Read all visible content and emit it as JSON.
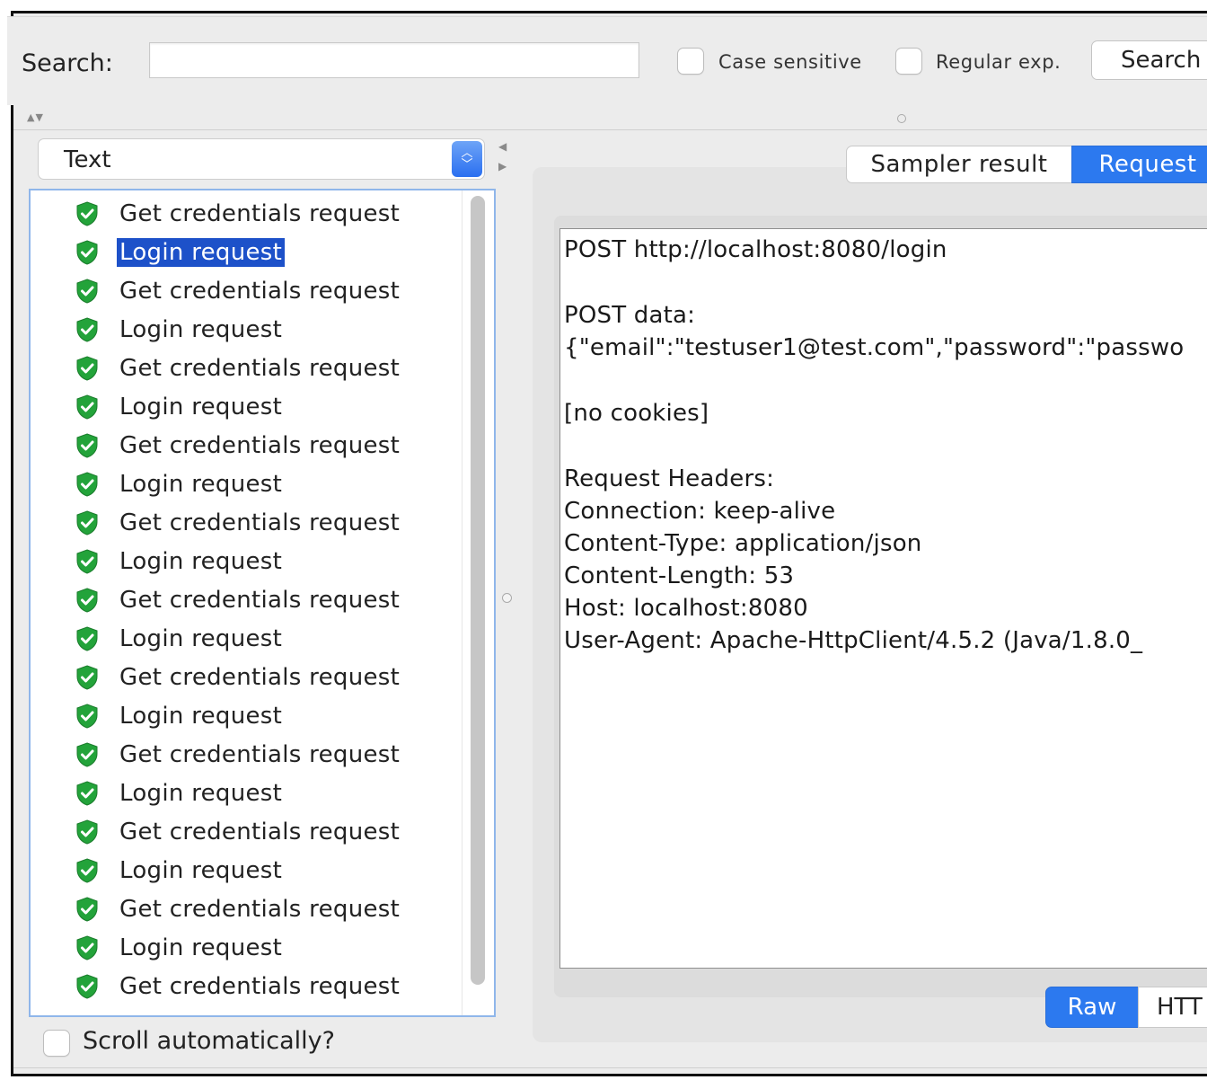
{
  "search": {
    "label": "Search:",
    "value": "",
    "case_sensitive_label": "Case sensitive",
    "regex_label": "Regular exp.",
    "button_label": "Search"
  },
  "renderer": {
    "selected": "Text"
  },
  "tree": {
    "items": [
      {
        "label": "Get credentials request",
        "status": "success"
      },
      {
        "label": "Login request",
        "status": "success",
        "selected": true
      },
      {
        "label": "Get credentials request",
        "status": "success"
      },
      {
        "label": "Login request",
        "status": "success"
      },
      {
        "label": "Get credentials request",
        "status": "success"
      },
      {
        "label": "Login request",
        "status": "success"
      },
      {
        "label": "Get credentials request",
        "status": "success"
      },
      {
        "label": "Login request",
        "status": "success"
      },
      {
        "label": "Get credentials request",
        "status": "success"
      },
      {
        "label": "Login request",
        "status": "success"
      },
      {
        "label": "Get credentials request",
        "status": "success"
      },
      {
        "label": "Login request",
        "status": "success"
      },
      {
        "label": "Get credentials request",
        "status": "success"
      },
      {
        "label": "Login request",
        "status": "success"
      },
      {
        "label": "Get credentials request",
        "status": "success"
      },
      {
        "label": "Login request",
        "status": "success"
      },
      {
        "label": "Get credentials request",
        "status": "success"
      },
      {
        "label": "Login request",
        "status": "success"
      },
      {
        "label": "Get credentials request",
        "status": "success"
      },
      {
        "label": "Login request",
        "status": "success"
      },
      {
        "label": "Get credentials request",
        "status": "success"
      }
    ]
  },
  "scroll_auto": {
    "label": "Scroll automatically?",
    "checked": false
  },
  "tabs": {
    "sampler_result": "Sampler result",
    "request": "Request",
    "active": "Request"
  },
  "request_text": {
    "lines": [
      "POST http://localhost:8080/login",
      "",
      "POST data:",
      "{\"email\":\"testuser1@test.com\",\"password\":\"passwo",
      "",
      "[no cookies]",
      "",
      "Request Headers:",
      "Connection: keep-alive",
      "Content-Type: application/json",
      "Content-Length: 53",
      "Host: localhost:8080",
      "User-Agent: Apache-HttpClient/4.5.2 (Java/1.8.0_"
    ]
  },
  "subtabs": {
    "raw": "Raw",
    "http": "HTT",
    "active": "Raw"
  },
  "colors": {
    "selection": "#1d51c9",
    "accent": "#2c79ef",
    "success_icon": "#23a33a",
    "background": "#ececec"
  }
}
